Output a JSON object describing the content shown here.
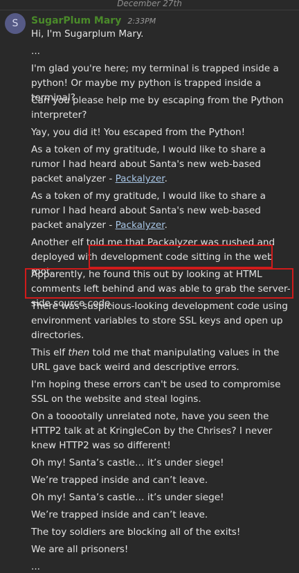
{
  "channel": {
    "date_divider": "December 27th"
  },
  "post": {
    "avatar_initial": "S",
    "author": "SugarPlum Mary",
    "time": "2:33PM"
  },
  "messages": {
    "m1": "Hi, I'm Sugarplum Mary.",
    "m2": "...",
    "m3": "I'm glad you're here; my terminal is trapped inside a python! Or maybe my python is trapped inside a terminal?",
    "m4": "Can you please help me by escaping from the Python interpreter?",
    "m5": "Yay, you did it! You escaped from the Python!",
    "m6_text": "As a token of my gratitude, I would like to share a rumor I had heard about Santa's new web-based packet analyzer - ",
    "m6_link": "Packalyzer",
    "m6_end": ".",
    "m7_text": "As a token of my gratitude, I would like to share a rumor I had heard about Santa's new web-based packet analyzer - ",
    "m7_link": "Packalyzer",
    "m7_end": ".",
    "m8": "Another elf told me that Packalyzer was rushed and deployed with development code sitting in the web root.",
    "m9": "Apparently, he found this out by looking at HTML comments left behind and was able to grab the server-side source code.",
    "m10": "There was suspicious-looking development code using environment variables to store SSL keys and open up directories.",
    "m11_a": "This elf ",
    "m11_em": "then",
    "m11_b": " told me that manipulating values in the URL gave back weird and descriptive errors.",
    "m12": "I'm hoping these errors can't be used to compromise SSL on the website and steal logins.",
    "m13": "On a tooootally unrelated note, have you seen the HTTP2 talk at at KringleCon by the Chrises? I never knew HTTP2 was so different!",
    "m14": "Oh my! Santa’s castle… it’s under siege!",
    "m15": "We’re trapped inside and can’t leave.",
    "m16": "Oh my! Santa’s castle… it’s under siege!",
    "m17": "We’re trapped inside and can’t leave.",
    "m18": "The toy soldiers are blocking all of the exits!",
    "m19": "We are all prisoners!",
    "m20": "..."
  },
  "highlight_color": "#d11b1b"
}
